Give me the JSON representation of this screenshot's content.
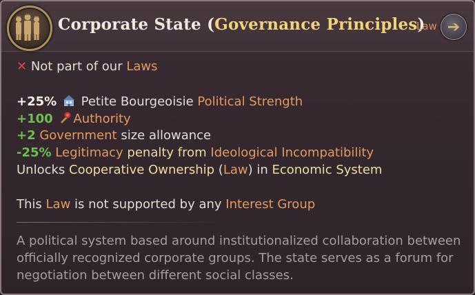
{
  "header": {
    "title_main": "Corporate State",
    "title_paren_open": " (",
    "title_group": "Governance Principles",
    "title_paren_close": ")",
    "law_label": "Law",
    "emblem_icon": "statesmen-emblem-icon",
    "next_icon": "arrow-right-icon"
  },
  "status": {
    "icon": "red-x-icon",
    "text": "Not part of our ",
    "link": "Laws"
  },
  "effects": [
    {
      "value": "+25%",
      "icon": "petite-bourgeoisie-icon",
      "pre": " Petite Bourgeoisie ",
      "hl": "Political Strength"
    },
    {
      "value": "+100",
      "icon": "authority-icon",
      "hl": "Authority"
    },
    {
      "value": "+2",
      "hl": "Government",
      "post": " size allowance"
    },
    {
      "value": "-25%",
      "hl": "Legitimacy",
      "mid": " penalty from ",
      "hl2": "Ideological Incompatibility"
    }
  ],
  "unlocks": {
    "pre": "Unlocks ",
    "item": "Cooperative Ownership",
    "paren_open": " (",
    "type": "Law",
    "paren_close": ")",
    "in": " in ",
    "category": "Economic System"
  },
  "support": {
    "pre": "This ",
    "law": "Law",
    "mid": " is not supported by any ",
    "group": "Interest Group"
  },
  "description": "A political system based around institutionalized collaboration between officially recognized corporate groups. The state serves as a forum for negotiation between different social classes.",
  "colors": {
    "highlight_orange": "#e39a5e",
    "highlight_yellow": "#f0dca0",
    "positive_green": "#6cbf52",
    "title_gold": "#f0d47a"
  }
}
